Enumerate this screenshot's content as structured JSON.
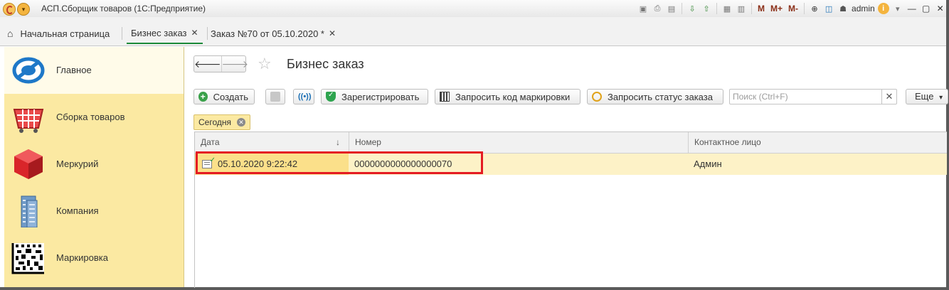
{
  "window": {
    "title": "АСП.Сборщик товаров  (1С:Предприятие)",
    "user": "admin",
    "toolbar_icons": [
      "save-icon",
      "print-icon",
      "preview-icon",
      "download-icon",
      "upload-icon",
      "calculator-icon",
      "calendar-icon"
    ],
    "memory_buttons": [
      "M",
      "M+",
      "M-"
    ]
  },
  "tabs": {
    "home_label": "Начальная страница",
    "items": [
      {
        "label": "Бизнес заказ",
        "active": true
      },
      {
        "label": "Заказ №70 от 05.10.2020 *",
        "active": false
      }
    ]
  },
  "sidebar": {
    "items": [
      {
        "label": "Главное",
        "icon": "globe-icon",
        "active": true
      },
      {
        "label": "Сборка товаров",
        "icon": "basket-icon",
        "active": false
      },
      {
        "label": "Меркурий",
        "icon": "cube-icon",
        "active": false
      },
      {
        "label": "Компания",
        "icon": "building-icon",
        "active": false
      },
      {
        "label": "Маркировка",
        "icon": "datamatrix-icon",
        "active": false
      }
    ]
  },
  "form": {
    "title": "Бизнес заказ",
    "toolbar": {
      "create_label": "Создать",
      "register_label": "Зарегистрировать",
      "request_marking_label": "Запросить код маркировки",
      "request_status_label": "Запросить статус заказа",
      "more_label": "Еще"
    },
    "search": {
      "placeholder": "Поиск (Ctrl+F)",
      "value": ""
    },
    "filter_chip": "Сегодня"
  },
  "table": {
    "columns": [
      "Дата",
      "Номер",
      "Контактное лицо"
    ],
    "sort_indicator": "↓",
    "rows": [
      {
        "date": "05.10.2020 9:22:42",
        "number": "0000000000000000070",
        "contact": "Админ"
      }
    ]
  },
  "colors": {
    "sidebar_bg": "#fbe9a2",
    "selected_row": "#fdf2c7",
    "highlight_frame": "#e41b23",
    "active_tab_underline": "#1b8a3a"
  }
}
